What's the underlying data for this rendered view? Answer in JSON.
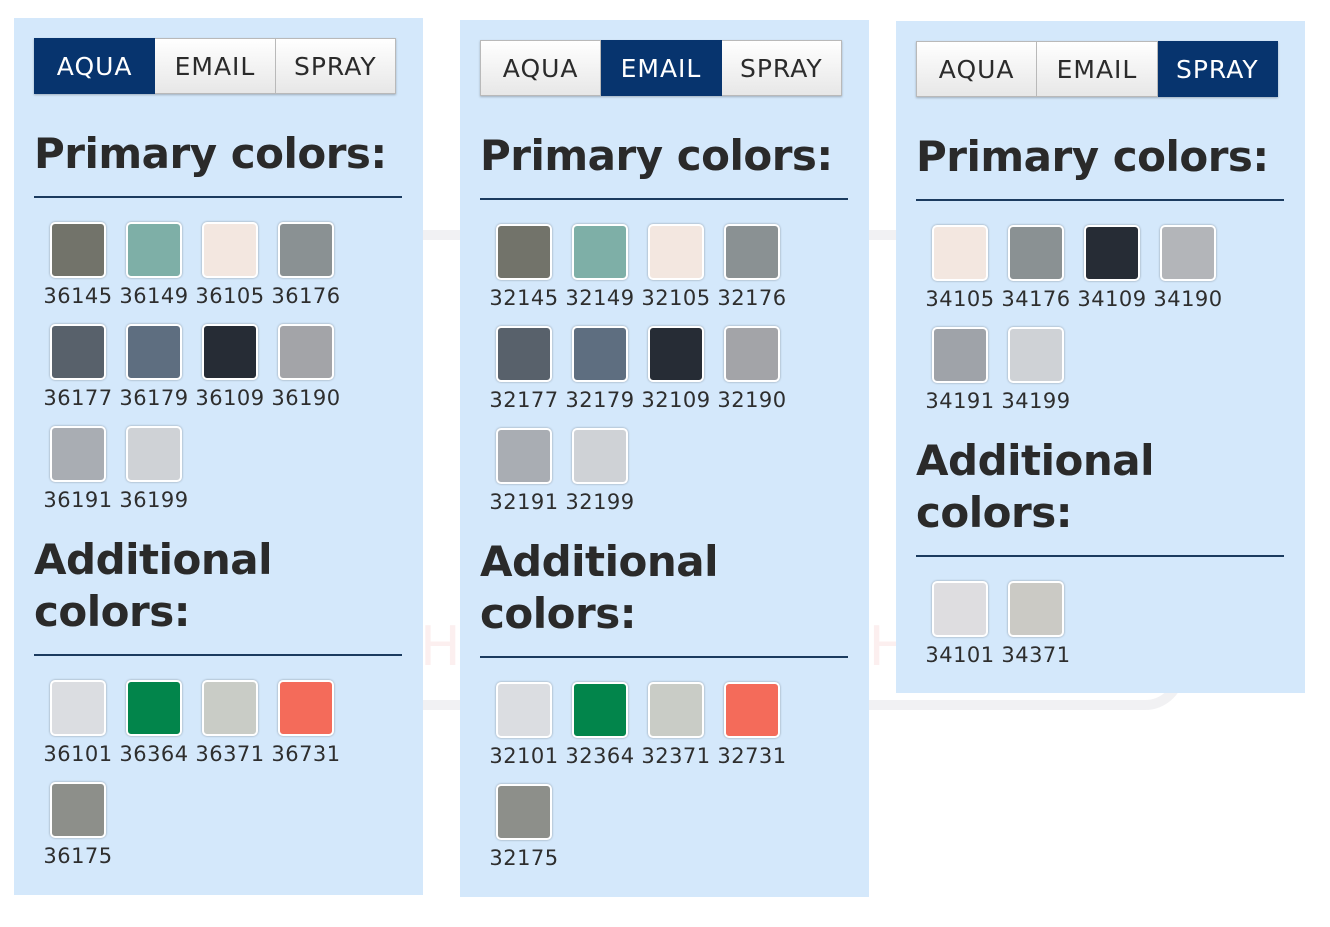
{
  "watermark": "HOBBY SHOP",
  "panels": [
    {
      "tabs": [
        "AQUA",
        "EMAIL",
        "SPRAY"
      ],
      "active": 0,
      "primary_heading": "Primary colors:",
      "additional_heading": "Additional colors:",
      "primary": [
        {
          "code": "36145",
          "color": "#72736a"
        },
        {
          "code": "36149",
          "color": "#7eafa7"
        },
        {
          "code": "36105",
          "color": "#f3e7e0"
        },
        {
          "code": "36176",
          "color": "#8a9193"
        },
        {
          "code": "36177",
          "color": "#58616b"
        },
        {
          "code": "36179",
          "color": "#5e6e80"
        },
        {
          "code": "36109",
          "color": "#262c35"
        },
        {
          "code": "36190",
          "color": "#a3a4a8"
        },
        {
          "code": "36191",
          "color": "#a9adb3"
        },
        {
          "code": "36199",
          "color": "#cfd2d6"
        }
      ],
      "additional": [
        {
          "code": "36101",
          "color": "#dbdde1"
        },
        {
          "code": "36364",
          "color": "#02854b"
        },
        {
          "code": "36371",
          "color": "#c9ccc6"
        },
        {
          "code": "36731",
          "color": "#f46b5a"
        },
        {
          "code": "36175",
          "color": "#8d8f8a"
        }
      ]
    },
    {
      "tabs": [
        "AQUA",
        "EMAIL",
        "SPRAY"
      ],
      "active": 1,
      "primary_heading": "Primary colors:",
      "additional_heading": "Additional colors:",
      "primary": [
        {
          "code": "32145",
          "color": "#72736a"
        },
        {
          "code": "32149",
          "color": "#7eafa7"
        },
        {
          "code": "32105",
          "color": "#f3e7e0"
        },
        {
          "code": "32176",
          "color": "#8a9193"
        },
        {
          "code": "32177",
          "color": "#58616b"
        },
        {
          "code": "32179",
          "color": "#5e6e80"
        },
        {
          "code": "32109",
          "color": "#262c35"
        },
        {
          "code": "32190",
          "color": "#a3a4a8"
        },
        {
          "code": "32191",
          "color": "#a9adb3"
        },
        {
          "code": "32199",
          "color": "#cfd2d6"
        }
      ],
      "additional": [
        {
          "code": "32101",
          "color": "#dbdde1"
        },
        {
          "code": "32364",
          "color": "#02854b"
        },
        {
          "code": "32371",
          "color": "#c9ccc6"
        },
        {
          "code": "32731",
          "color": "#f46b5a"
        },
        {
          "code": "32175",
          "color": "#8d8f8a"
        }
      ]
    },
    {
      "tabs": [
        "AQUA",
        "EMAIL",
        "SPRAY"
      ],
      "active": 2,
      "primary_heading": "Primary colors:",
      "additional_heading": "Additional colors:",
      "primary": [
        {
          "code": "34105",
          "color": "#f3e7e0"
        },
        {
          "code": "34176",
          "color": "#8a9193"
        },
        {
          "code": "34109",
          "color": "#262c35"
        },
        {
          "code": "34190",
          "color": "#b3b5b9"
        },
        {
          "code": "34191",
          "color": "#9fa3a9"
        },
        {
          "code": "34199",
          "color": "#cfd2d6"
        }
      ],
      "additional": [
        {
          "code": "34101",
          "color": "#dedde0"
        },
        {
          "code": "34371",
          "color": "#cbcac5"
        }
      ]
    }
  ]
}
